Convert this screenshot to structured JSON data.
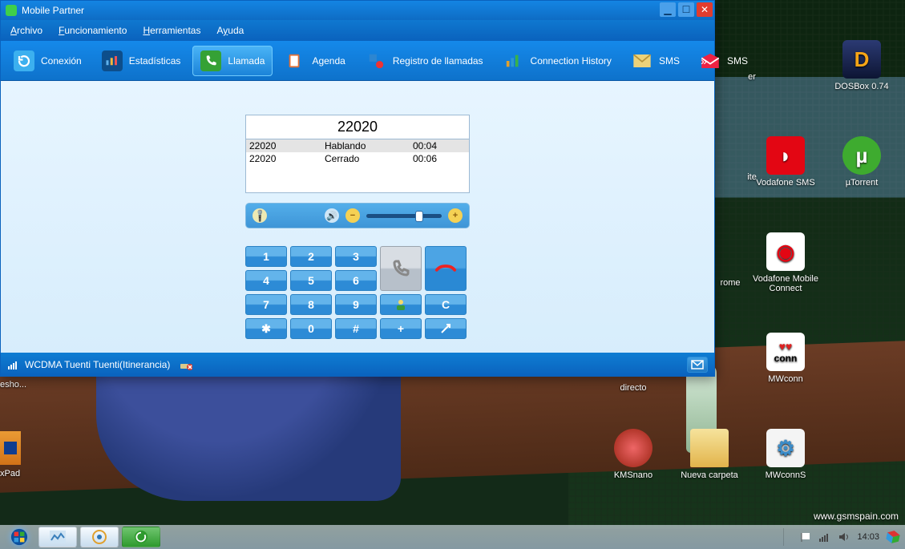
{
  "app": {
    "title": "Mobile Partner"
  },
  "menu": {
    "archivo": "Archivo",
    "funcionamiento": "Funcionamiento",
    "herramientas": "Herramientas",
    "ayuda": "Ayuda"
  },
  "toolbar": {
    "conexion": "Conexión",
    "estadisticas": "Estadísticas",
    "llamada": "Llamada",
    "agenda": "Agenda",
    "registro": "Registro de llamadas",
    "connhist": "Connection History",
    "sms1": "SMS",
    "sms2": "SMS"
  },
  "call": {
    "title": "22020",
    "rows": [
      {
        "num": "22020",
        "state": "Hablando",
        "time": "00:04"
      },
      {
        "num": "22020",
        "state": "Cerrado",
        "time": "00:06"
      }
    ]
  },
  "keypad": {
    "k1": "1",
    "k2": "2",
    "k3": "3",
    "k4": "4",
    "k5": "5",
    "k6": "6",
    "k7": "7",
    "k8": "8",
    "k9": "9",
    "kstar": "✱",
    "k0": "0",
    "khash": "#",
    "kplus": "+",
    "kC": "C"
  },
  "status": {
    "network": "WCDMA  Tuenti Tuenti(Itinerancia)"
  },
  "desktop": {
    "dosbox": "DOSBox 0.74",
    "vodasms": "Vodafone SMS",
    "utorrent": "µTorrent",
    "chrome": "rome",
    "vodaconnect": "Vodafone Mobile Connect",
    "mwconn": "MWconn",
    "kmsnano": "KMSnano",
    "nuevacarpeta": "Nueva carpeta",
    "mwconns": "MWconnS",
    "directo": "directo",
    "leftpartial": "esho...",
    "xpad": "xPad",
    "partial_ite": "ite"
  },
  "tray": {
    "time": "14:03"
  },
  "watermark": "www.gsmspain.com"
}
